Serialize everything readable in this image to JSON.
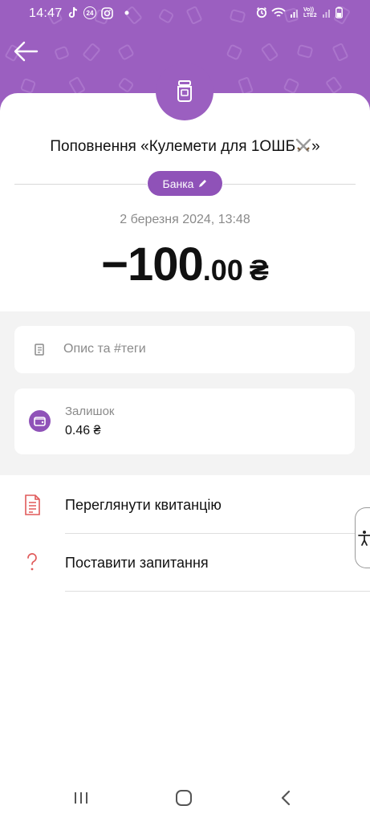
{
  "status_bar": {
    "time": "14:47",
    "left_icons": [
      "tiktok-icon",
      "badge-24-icon",
      "instagram-icon",
      "dot-icon"
    ],
    "right_icons": [
      "alarm-icon",
      "wifi-icon",
      "signal-icon",
      "volte-icon",
      "signal-icon",
      "battery-icon"
    ],
    "volte_label": "Vo)) LTE2",
    "badge_24": "24"
  },
  "header": {
    "background_color": "#9b5fc0",
    "back_icon": "arrow-left-icon",
    "jar_icon": "jar-icon"
  },
  "transaction": {
    "title": "Поповнення «Кулемети для 1ОШБ",
    "title_emoji": "crossed-swords-emoji",
    "title_close": "»",
    "category_chip": "Банка",
    "chip_icon": "pencil-icon",
    "datetime": "2 березня 2024, 13:48",
    "amount_int": "−100",
    "amount_frac": ".00",
    "currency": "₴"
  },
  "details": {
    "description_placeholder": "Опис та #теги",
    "balance_label": "Залишок",
    "balance_value": "0.46 ₴"
  },
  "actions": [
    {
      "label": "Переглянути квитанцію",
      "icon": "receipt-icon"
    },
    {
      "label": "Поставити запитання",
      "icon": "question-icon"
    }
  ],
  "accessibility_icon": "accessibility-icon",
  "navbar": [
    "recent-apps-icon",
    "home-icon",
    "back-icon"
  ],
  "colors": {
    "accent": "#8f52b8",
    "icon_red": "#e05a5a"
  }
}
